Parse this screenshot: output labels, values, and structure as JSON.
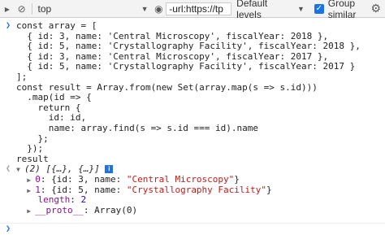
{
  "toolbar": {
    "context": "top",
    "filter_value": "-url:https://tp",
    "levels": "Default levels",
    "group_similar": "Group similar"
  },
  "code_lines": [
    "const array = [",
    "  { id: 3, name: 'Central Microscopy', fiscalYear: 2018 },",
    "  { id: 5, name: 'Crystallography Facility', fiscalYear: 2018 },",
    "  { id: 3, name: 'Central Microscopy', fiscalYear: 2017 },",
    "  { id: 5, name: 'Crystallography Facility', fiscalYear: 2017 }",
    "];",
    "const result = Array.from(new Set(array.map(s => s.id)))",
    "  .map(id => {",
    "    return {",
    "      id: id,",
    "      name: array.find(s => s.id === id).name",
    "    };",
    "  });",
    "result"
  ],
  "output": {
    "summary": "(2) [{…}, {…}]",
    "items": [
      {
        "index": "0",
        "text": "{id: 3, name: ",
        "name": "\"Central Microscopy\"",
        "close": "}"
      },
      {
        "index": "1",
        "text": "{id: 5, name: ",
        "name": "\"Crystallography Facility\"",
        "close": "}"
      }
    ],
    "length_key": "length",
    "length_value": "2",
    "proto_key": "__proto__",
    "proto_value": "Array(0)"
  },
  "gutter": {
    "input_prompt": "❯",
    "output_marker": "❮"
  }
}
